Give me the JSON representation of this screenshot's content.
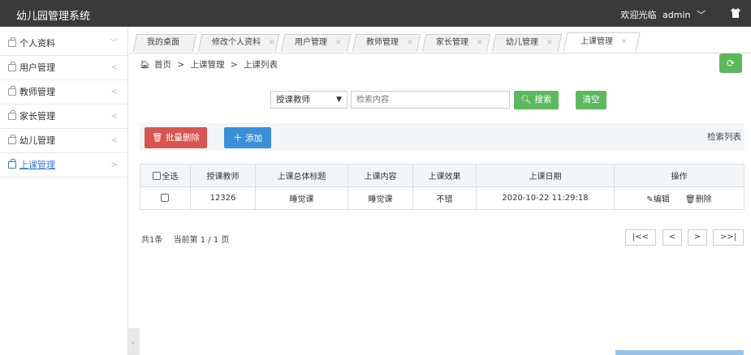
{
  "app": {
    "title": "幼儿园管理系统",
    "welcome": "欢迎光临",
    "user": "admin"
  },
  "sidebar": {
    "items": [
      {
        "label": "个人资料",
        "arrow": "﹀"
      },
      {
        "label": "用户管理",
        "arrow": "<"
      },
      {
        "label": "教师管理",
        "arrow": "<"
      },
      {
        "label": "家长管理",
        "arrow": "<"
      },
      {
        "label": "幼儿管理",
        "arrow": "<"
      },
      {
        "label": "上课管理",
        "arrow": ">"
      }
    ]
  },
  "tabs": [
    {
      "label": "我的桌面"
    },
    {
      "label": "修改个人资料"
    },
    {
      "label": "用户管理"
    },
    {
      "label": "教师管理"
    },
    {
      "label": "家长管理"
    },
    {
      "label": "幼儿管理"
    },
    {
      "label": "上课管理"
    }
  ],
  "breadcrumb": {
    "home": "首页",
    "section": "上课管理",
    "page": "上课列表",
    "sep": ">"
  },
  "search": {
    "field": "授课教师",
    "placeholder": "检索内容",
    "search_label": "搜索",
    "clear_label": "清空"
  },
  "toolbar": {
    "batch_delete": "批量删除",
    "add": "添加",
    "list_title": "检索列表"
  },
  "table": {
    "headers": [
      "全选",
      "授课教师",
      "上课总体标题",
      "上课内容",
      "上课效果",
      "上课日期",
      "操作"
    ],
    "rows": [
      {
        "teacher": "12326",
        "title": "睡觉课",
        "content": "睡觉课",
        "effect": "不错",
        "date": "2020-10-22 11:29:18",
        "edit": "编辑",
        "delete": "删除"
      }
    ]
  },
  "pagination": {
    "total": "共1条",
    "current": "当前第 1 / 1 页",
    "first": "|<<",
    "prev": "<",
    "next": ">",
    "last": ">>|"
  },
  "colors": {
    "topbar": "#3a3a3a",
    "green": "#5cb85c",
    "red": "#d9534f",
    "blue": "#3b8fd9",
    "link": "#3b7ad8"
  }
}
